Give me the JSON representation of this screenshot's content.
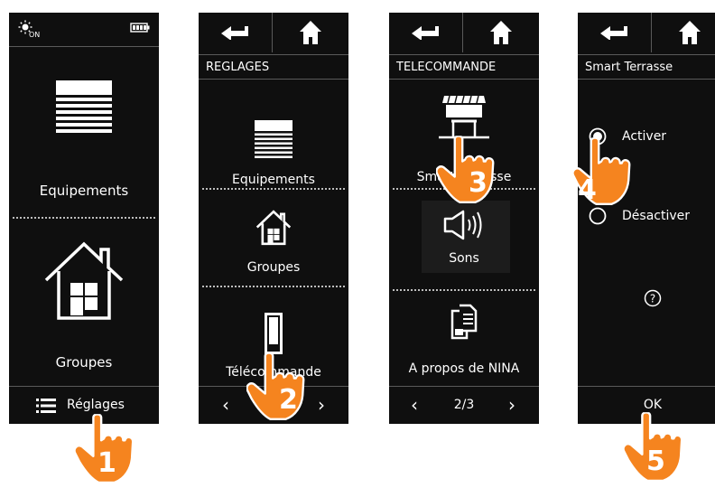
{
  "screen1": {
    "items": [
      {
        "label": "Equipements",
        "icon": "blind-icon"
      },
      {
        "label": "Groupes",
        "icon": "house-icon"
      }
    ],
    "bottom_label": "Réglages",
    "icons": {
      "status": "sun-on-icon",
      "battery": "battery-icon",
      "menu": "list-menu-icon"
    }
  },
  "screen2": {
    "title": "REGLAGES",
    "items": [
      {
        "label": "Equipements",
        "icon": "blind-icon"
      },
      {
        "label": "Groupes",
        "icon": "house-icon"
      },
      {
        "label": "Télécommande",
        "icon": "remote-icon"
      }
    ]
  },
  "screen3": {
    "title": "TELECOMMANDE",
    "items": [
      {
        "label": "Smart Terrasse",
        "icon": "awning-icon"
      },
      {
        "label": "Sons",
        "icon": "speaker-icon"
      },
      {
        "label": "A propos de NINA",
        "icon": "documents-icon"
      }
    ],
    "page": "2/3"
  },
  "screen4": {
    "title": "Smart Terrasse",
    "options": [
      {
        "label": "Activer",
        "selected": true
      },
      {
        "label": "Désactiver",
        "selected": false
      }
    ],
    "ok_label": "OK"
  },
  "steps": [
    "1",
    "2",
    "3",
    "4",
    "5"
  ],
  "colors": {
    "screen_bg": "#0f0f0f",
    "text": "#ffffff",
    "hand_orange": "#f5841f",
    "divider": "#5a5a5a"
  }
}
